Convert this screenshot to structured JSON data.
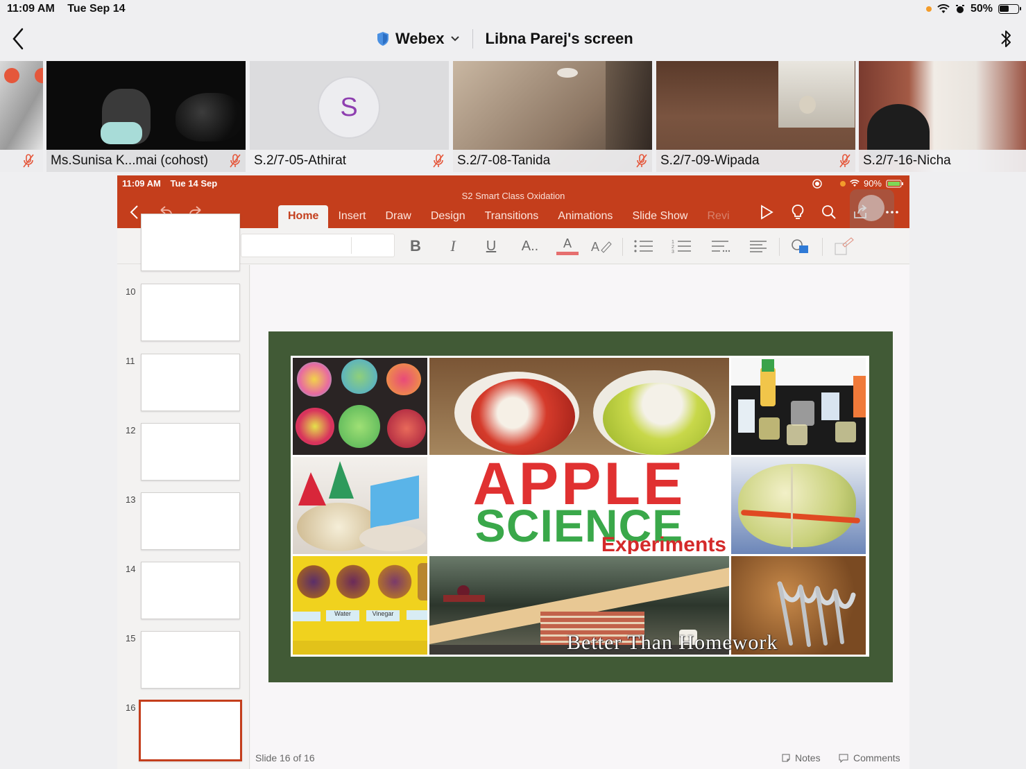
{
  "status_bar": {
    "time": "11:09 AM",
    "date": "Tue Sep 14",
    "battery": "50%"
  },
  "webex": {
    "brand": "Webex",
    "screen_title": "Libna Parej's screen"
  },
  "participants": [
    {
      "name": "Ms.Sunisa K...mai (cohost)"
    },
    {
      "name": "S.2/7-05-Athirat",
      "avatar_letter": "S"
    },
    {
      "name": "S.2/7-08-Tanida"
    },
    {
      "name": "S.2/7-09-Wipada"
    },
    {
      "name": "S.2/7-16-Nicha"
    }
  ],
  "ppt": {
    "status_time": "11:09 AM",
    "status_date": "Tue 14 Sep",
    "battery": "90%",
    "doc_title": "S2 Smart Class Oxidation",
    "tabs": [
      "Home",
      "Insert",
      "Draw",
      "Design",
      "Transitions",
      "Animations",
      "Slide Show",
      "Revi"
    ],
    "thumbnails": [
      "10",
      "11",
      "12",
      "13",
      "14",
      "15",
      "16"
    ],
    "slide": {
      "title_line1": "APPLE",
      "title_line2": "SCIENCE",
      "title_line3": "Experiments",
      "caption": "Better Than Homework",
      "water_label": "Water",
      "vinegar_label": "Vinegar"
    },
    "footer": {
      "slide_counter": "Slide 16 of 16",
      "notes": "Notes",
      "comments": "Comments"
    }
  },
  "colors": {
    "ppt_accent": "#c43e1c",
    "slide_frame": "#415a36",
    "title_red": "#e03131",
    "title_green": "#3aa84a"
  }
}
